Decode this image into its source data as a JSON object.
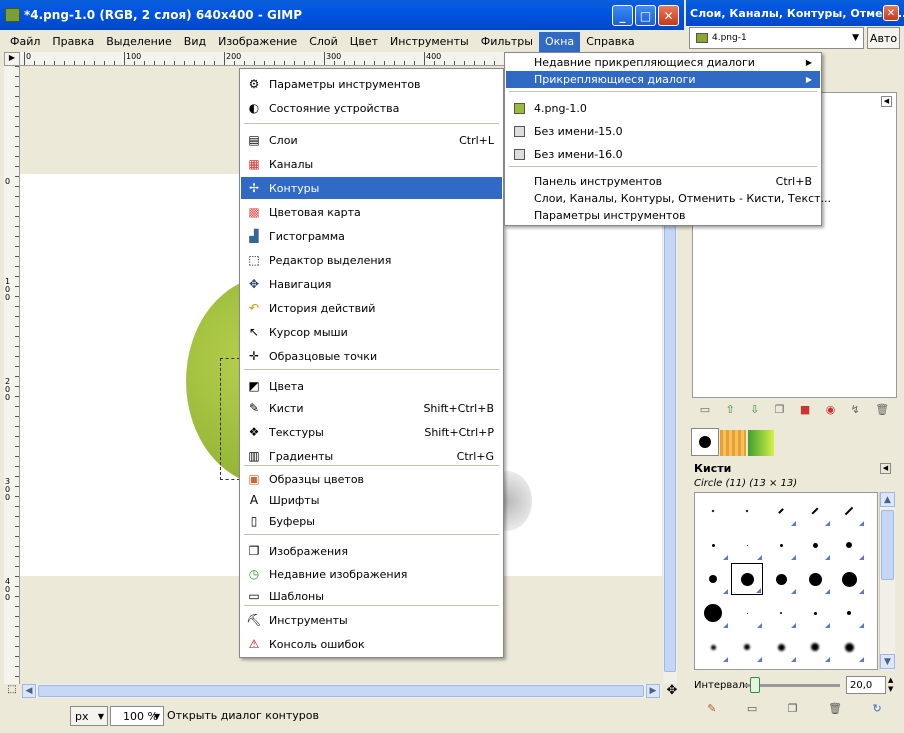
{
  "gimp": {
    "title": "*4.png-1.0 (RGB, 2 слоя) 640x400 - GIMP",
    "menubar": [
      "Файл",
      "Правка",
      "Выделение",
      "Вид",
      "Изображение",
      "Слой",
      "Цвет",
      "Инструменты",
      "Фильтры",
      "Окна",
      "Справка"
    ],
    "active_menu_index": 9,
    "ruler_h_labels": [
      "0",
      "100",
      "200",
      "300",
      "400"
    ],
    "ruler_v_labels": [
      "0",
      "100",
      "200",
      "300",
      "400"
    ],
    "status": {
      "unit": "px",
      "zoom": "100 %",
      "message": "Открыть диалог контуров"
    }
  },
  "windows_menu": {
    "items": [
      {
        "label": "Параметры инструментов",
        "shortcut": "",
        "icon": "tool-options-icon"
      },
      {
        "label": "Состояние устройства",
        "shortcut": "",
        "icon": "device-status-icon"
      },
      {
        "label": "Слои",
        "shortcut": "Ctrl+L",
        "icon": "layers-icon"
      },
      {
        "label": "Каналы",
        "shortcut": "",
        "icon": "channels-icon"
      },
      {
        "label": "Контуры",
        "shortcut": "",
        "icon": "paths-icon"
      },
      {
        "label": "Цветовая карта",
        "shortcut": "",
        "icon": "colormap-icon"
      },
      {
        "label": "Гистограмма",
        "shortcut": "",
        "icon": "histogram-icon"
      },
      {
        "label": "Редактор выделения",
        "shortcut": "",
        "icon": "selection-editor-icon"
      },
      {
        "label": "Навигация",
        "shortcut": "",
        "icon": "navigation-icon"
      },
      {
        "label": "История действий",
        "shortcut": "",
        "icon": "undo-history-icon"
      },
      {
        "label": "Курсор мыши",
        "shortcut": "",
        "icon": "pointer-icon"
      },
      {
        "label": "Образцовые точки",
        "shortcut": "",
        "icon": "sample-points-icon"
      },
      {
        "label": "Цвета",
        "shortcut": "",
        "icon": "colors-icon"
      },
      {
        "label": "Кисти",
        "shortcut": "Shift+Ctrl+B",
        "icon": "brushes-icon"
      },
      {
        "label": "Текстуры",
        "shortcut": "Shift+Ctrl+P",
        "icon": "patterns-icon"
      },
      {
        "label": "Градиенты",
        "shortcut": "Ctrl+G",
        "icon": "gradients-icon"
      },
      {
        "label": "Образцы цветов",
        "shortcut": "",
        "icon": "palettes-icon"
      },
      {
        "label": "Шрифты",
        "shortcut": "",
        "icon": "fonts-icon"
      },
      {
        "label": "Буферы",
        "shortcut": "",
        "icon": "buffers-icon"
      },
      {
        "label": "Изображения",
        "shortcut": "",
        "icon": "images-icon"
      },
      {
        "label": "Недавние изображения",
        "shortcut": "",
        "icon": "recent-images-icon"
      },
      {
        "label": "Шаблоны",
        "shortcut": "",
        "icon": "templates-icon"
      },
      {
        "label": "Инструменты",
        "shortcut": "",
        "icon": "tools-icon"
      },
      {
        "label": "Консоль ошибок",
        "shortcut": "",
        "icon": "error-console-icon"
      }
    ],
    "highlighted_index": 4
  },
  "dockable_submenu": {
    "items": [
      {
        "label": "Недавние прикрепляющиеся диалоги",
        "has_sub": true
      },
      {
        "label": "Прикрепляющиеся диалоги",
        "has_sub": true
      },
      {
        "label": "4.png-1.0",
        "has_sub": false
      },
      {
        "label": "Без имени-15.0",
        "has_sub": false
      },
      {
        "label": "Без имени-16.0",
        "has_sub": false
      },
      {
        "label": "Панель инструментов",
        "shortcut": "Ctrl+B"
      },
      {
        "label": "Слои, Каналы, Контуры, Отменить - Кисти, Текст...",
        "shortcut": ""
      },
      {
        "label": "Параметры инструментов",
        "shortcut": ""
      }
    ],
    "highlighted_index": 1
  },
  "dock": {
    "title": "Слои, Каналы, Контуры, Отмени...",
    "image_select": "4.png-1",
    "auto_button": "Авто",
    "brushes_title": "Кисти",
    "brush_info": "Circle (11) (13 × 13)",
    "spacing_label": "Интервал:",
    "spacing_value": "20,0"
  },
  "colors": {
    "xp_blue": "#0054e3",
    "menu_highlight": "#316ac5",
    "image_green": "#9bbb3a"
  }
}
